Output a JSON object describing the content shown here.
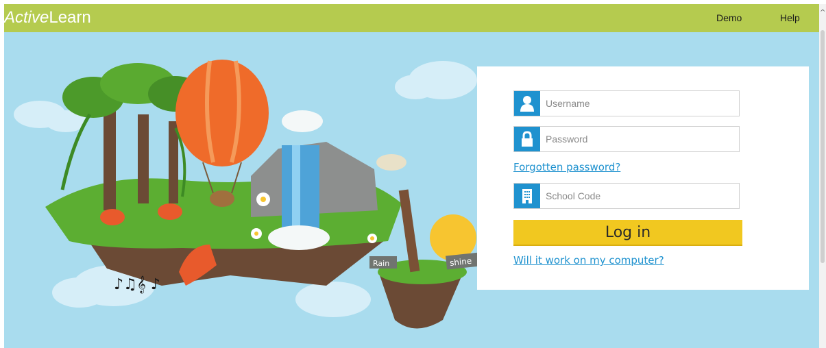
{
  "header": {
    "logo_word1": "Active",
    "logo_word2": "Learn",
    "nav": {
      "demo": "Demo",
      "help": "Help"
    }
  },
  "illustration": {
    "sign_rain": "Rain",
    "sign_shine": "shine"
  },
  "login": {
    "username_placeholder": "Username",
    "password_placeholder": "Password",
    "forgot_link": "Forgotten password?",
    "school_code_placeholder": "School Code",
    "login_button": "Log in",
    "compat_link": "Will it work on my computer?"
  },
  "colors": {
    "header_bg": "#b5cb4f",
    "sky": "#a9dcee",
    "icon_bg": "#1f92cf",
    "link": "#1f92cf",
    "button": "#f1c820"
  },
  "icons": {
    "username": "user-icon",
    "password": "lock-icon",
    "school": "building-icon",
    "scroll": "chevron-up-icon"
  }
}
